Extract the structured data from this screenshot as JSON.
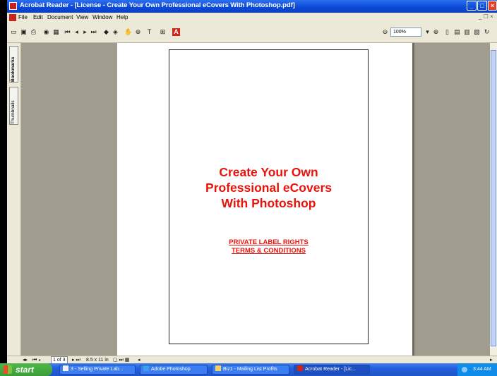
{
  "window": {
    "title": "Acrobat Reader - [License - Create Your Own Professional eCovers With Photoshop.pdf]",
    "controls": {
      "minimize": "_",
      "maximize": "□",
      "close": "×"
    }
  },
  "menubar": {
    "items": [
      "File",
      "Edit",
      "Document",
      "View",
      "Window",
      "Help"
    ],
    "mdi_controls": "_ ☐ ×"
  },
  "toolbar": {
    "zoom": "100%",
    "icons": [
      "open-icon",
      "save-icon",
      "print-icon",
      "find-icon",
      "table-icon",
      "first-page-icon",
      "prev-page-icon",
      "next-page-icon",
      "last-page-icon",
      "back-icon",
      "forward-icon",
      "hand-tool-icon",
      "zoom-tool-icon",
      "text-select-icon",
      "column-select-icon",
      "adobe-logo-icon"
    ]
  },
  "sidebar": {
    "tabs": [
      "Bookmarks",
      "Thumbnails"
    ]
  },
  "document": {
    "title_lines": [
      "Create Your Own",
      "Professional eCovers",
      "With Photoshop"
    ],
    "links": [
      "PRIVATE LABEL RIGHTS",
      "TERMS & CONDITIONS"
    ]
  },
  "statusbar": {
    "page_indicator": "1 of 3",
    "page_size": "8.5 x 11 in"
  },
  "taskbar": {
    "start_label": "start",
    "tasks": [
      {
        "label": "3 - Selling Private Lab...",
        "active": false
      },
      {
        "label": "Adobe Photoshop",
        "active": false
      },
      {
        "label": "Biz1 - Mailing List Profits",
        "active": false
      },
      {
        "label": "Acrobat Reader - [Lic...",
        "active": true
      }
    ],
    "clock": "3:44 AM"
  },
  "colors": {
    "title_red": "#e8140c",
    "titlebar_blue": "#0a48d6",
    "taskbar_blue": "#245edb",
    "gray_background": "#a19d8e"
  }
}
